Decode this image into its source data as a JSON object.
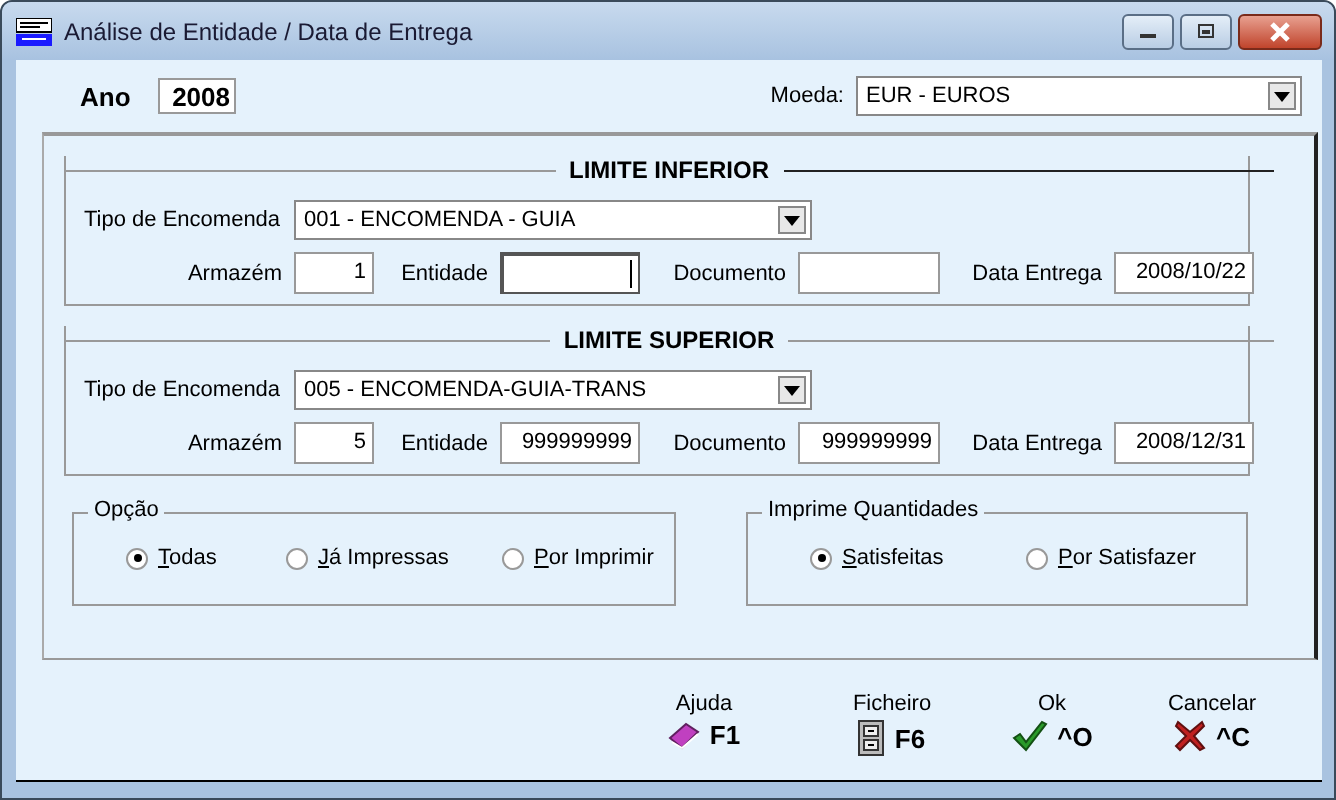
{
  "window": {
    "title": "Análise de Entidade / Data de Entrega"
  },
  "ano": {
    "label": "Ano",
    "value": "2008"
  },
  "moeda": {
    "label": "Moeda:",
    "value": "EUR - EUROS"
  },
  "limits": [
    {
      "title": "LIMITE INFERIOR",
      "tipo_label": "Tipo de Encomenda",
      "tipo": "001 - ENCOMENDA - GUIA",
      "fields": [
        {
          "label": "Armazém",
          "value": "1",
          "focused": false
        },
        {
          "label": "Entidade",
          "focused": true
        },
        {
          "label": "Documento",
          "focused": false
        },
        {
          "label": "Data Entrega",
          "value": "2008/10/22",
          "focused": false
        }
      ]
    },
    {
      "title": "LIMITE SUPERIOR",
      "tipo_label": "Tipo de Encomenda",
      "tipo": "005 - ENCOMENDA-GUIA-TRANS",
      "fields": [
        {
          "label": "Armazém",
          "value": "5",
          "focused": false
        },
        {
          "label": "Entidade",
          "value": "999999999",
          "focused": false
        },
        {
          "label": "Documento",
          "value": "999999999",
          "focused": false
        },
        {
          "label": "Data Entrega",
          "value": "2008/12/31",
          "focused": false
        }
      ]
    }
  ],
  "groups": [
    {
      "title": "Opção",
      "options": [
        {
          "label": "Todas",
          "selected": true
        },
        {
          "label": "Já Impressas",
          "selected": false
        },
        {
          "label": "Por Imprimir",
          "selected": false
        }
      ]
    },
    {
      "title": "Imprime Quantidades",
      "options": [
        {
          "label": "Satisfeitas",
          "selected": true
        },
        {
          "label": "Por Satisfazer",
          "selected": false
        }
      ]
    }
  ],
  "buttons": [
    {
      "kind": "help",
      "label": "Ajuda",
      "key": "F1"
    },
    {
      "kind": "file",
      "label": "Ficheiro",
      "key": "F6"
    },
    {
      "kind": "ok",
      "label": "Ok",
      "key": "^O"
    },
    {
      "kind": "cancel",
      "label": "Cancelar",
      "key": "^C"
    }
  ]
}
